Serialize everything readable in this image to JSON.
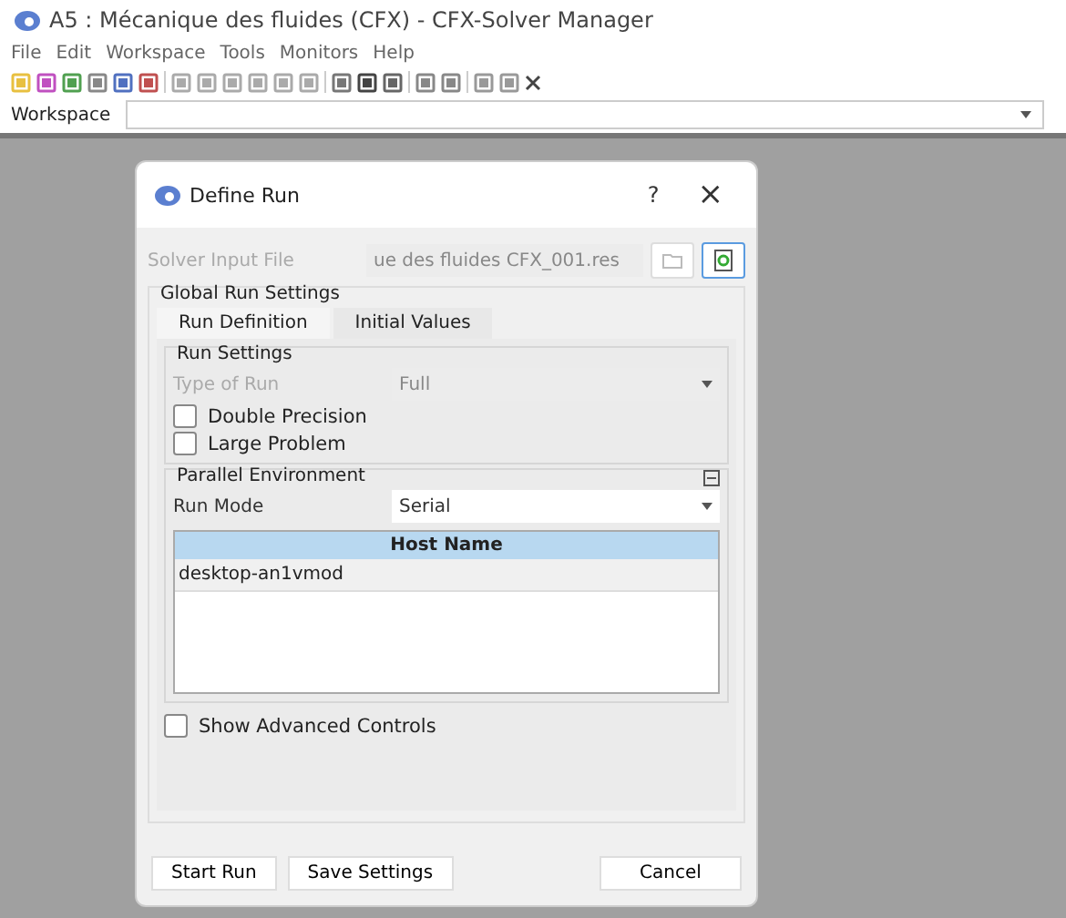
{
  "window": {
    "title": "A5 : Mécanique des fluides (CFX) - CFX-Solver Manager"
  },
  "menu": [
    "File",
    "Edit",
    "Workspace",
    "Tools",
    "Monitors",
    "Help"
  ],
  "workspace": {
    "label": "Workspace"
  },
  "dialog": {
    "title": "Define Run",
    "help": "?",
    "close": "×",
    "solver_input": {
      "label": "Solver Input File",
      "value": "ue des fluides CFX_001.res",
      "disabled": true
    },
    "global_group": "Global Run Settings",
    "tabs": [
      {
        "label": "Run Definition",
        "selected": true
      },
      {
        "label": "Initial Values",
        "selected": false
      }
    ],
    "run_settings": {
      "title": "Run Settings",
      "type_label": "Type of Run",
      "type_value": "Full",
      "disabled": true,
      "checkboxes": [
        {
          "label": "Double Precision",
          "checked": false
        },
        {
          "label": "Large Problem",
          "checked": false
        }
      ]
    },
    "parallel": {
      "title": "Parallel Environment",
      "expanded": true,
      "mode_label": "Run Mode",
      "mode_value": "Serial",
      "table": {
        "columns": [
          "Host Name"
        ],
        "rows": [
          {
            "cells": [
              "desktop-an1vmod"
            ],
            "selected": false
          }
        ]
      }
    },
    "advanced": {
      "label": "Show Advanced Controls",
      "checked": false
    },
    "buttons": [
      "Start Run",
      "Save Settings",
      "Cancel"
    ]
  }
}
